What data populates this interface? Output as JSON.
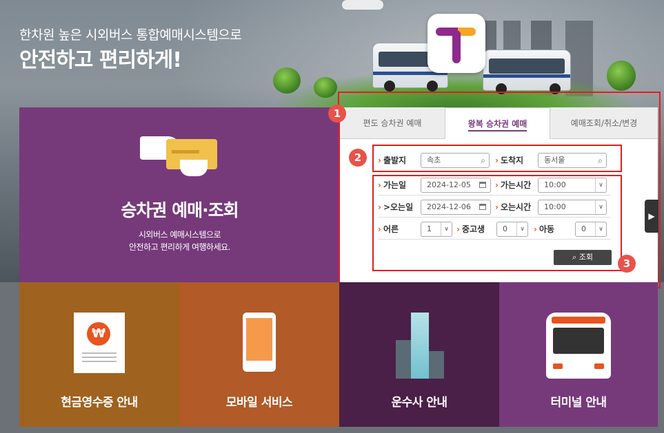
{
  "hero": {
    "subtitle": "한차원 높은 시외버스 통합예매시스템으로",
    "title": "안전하고 편리하게!"
  },
  "ticket_panel": {
    "title": "승차권 예매·조회",
    "desc_line1": "시외버스 예매시스템으로",
    "desc_line2": "안전하고 편리하게 여행하세요."
  },
  "tabs": [
    {
      "label": "편도 승차권 예매",
      "active": false
    },
    {
      "label": "왕복 승차권 예매",
      "active": true
    },
    {
      "label": "예매조회/취소/변경",
      "active": false
    }
  ],
  "form": {
    "departure_label": "출발지",
    "departure_value": "속초",
    "arrival_label": "도착지",
    "arrival_value": "동서울",
    "go_date_label": "가는일",
    "go_date_value": "2024-12-05",
    "go_time_label": "가는시간",
    "go_time_value": "10:00",
    "return_date_label": ">오는일",
    "return_date_value": "2024-12-06",
    "return_time_label": "오는시간",
    "return_time_value": "10:00",
    "adult_label": "어른",
    "adult_value": "1",
    "youth_label": "중고생",
    "youth_value": "0",
    "child_label": "아동",
    "child_value": "0",
    "search_label": "조회"
  },
  "badges": [
    "1",
    "2",
    "3"
  ],
  "tiles": [
    {
      "label": "현금영수증 안내",
      "color": "#a0621f"
    },
    {
      "label": "모바일 서비스",
      "color": "#b25a28"
    },
    {
      "label": "운수사 안내",
      "color": "#4a1f48"
    },
    {
      "label": "터미널 안내",
      "color": "#763a7a"
    }
  ],
  "colors": {
    "accent": "#763a7a",
    "annotation": "#e41d1d",
    "badge": "#e9524a"
  }
}
